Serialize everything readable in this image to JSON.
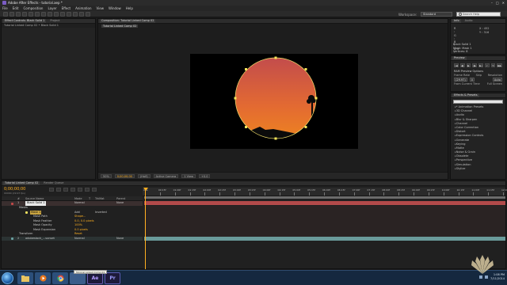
{
  "window": {
    "title": "Adobe After Effects - tutorial.aep *",
    "controls": [
      "–",
      "□",
      "✕"
    ]
  },
  "menu": [
    "File",
    "Edit",
    "Composition",
    "Layer",
    "Effect",
    "Animation",
    "View",
    "Window",
    "Help"
  ],
  "toolbar": {
    "workspace_label": "Workspace:",
    "workspace_value": "Standard",
    "search_placeholder": "Search Help"
  },
  "left_panel": {
    "tabs": [
      "Effect Controls: Black Solid 1",
      "Project"
    ],
    "subtitle": "Tutorial Linked Comp 02 • Black Solid 1"
  },
  "comp_panel": {
    "tab": "Composition: Tutorial Linked Comp 02",
    "subtab": "Tutorial Linked Comp 02",
    "footer": {
      "zoom": "50%",
      "timecode": "0;00;00;00",
      "resolution": "(Half)",
      "camera": "Active Camera",
      "views": "1 View",
      "offset": "+0.0"
    }
  },
  "info_panel": {
    "tabs": [
      "Info",
      "Audio"
    ],
    "rgb": [
      [
        "R :",
        ""
      ],
      [
        "G :",
        ""
      ],
      [
        "B :",
        ""
      ],
      [
        "A :",
        "0"
      ]
    ],
    "x": "X : 452",
    "y": "Y : 316",
    "layer_name": "Black Solid 1",
    "mask": "Mask: Mask 1",
    "vertices": "Vertices: 8"
  },
  "preview_panel": {
    "tab": "Preview",
    "ram_options": "RAM Preview Options",
    "frame_rate_label": "Frame Rate",
    "skip_label": "Skip",
    "resolution_label": "Resolution",
    "frame_rate_value": "(29.97)",
    "skip_value": "0",
    "resolution_value": "Auto",
    "from_current": "From Current Time",
    "full_screen": "Full Screen"
  },
  "effects_panel": {
    "tab": "Effects & Presets",
    "categories": [
      "* Animation Presets",
      "3D Channel",
      "Audio",
      "Blur & Sharpen",
      "Channel",
      "Color Correction",
      "Distort",
      "Expression Controls",
      "Generate",
      "Keying",
      "Matte",
      "Noise & Grain",
      "Obsolete",
      "Perspective",
      "Simulation",
      "Stylize"
    ]
  },
  "timeline": {
    "tabs": [
      "Tutorial Linked Comp 02",
      "Render Queue"
    ],
    "timecode": "0;00;00;00",
    "frames_fps": "00000 (29.97 fps)",
    "column_headers": [
      "#",
      "Source Name",
      "Mode",
      "T",
      "TrkMat",
      "Parent"
    ],
    "ruler_ticks": [
      "00s",
      "00:15f",
      "01:00f",
      "01:15f",
      "02:00f",
      "02:15f",
      "03:00f",
      "03:15f",
      "04:00f",
      "04:15f",
      "05:00f",
      "05:15f",
      "06:00f",
      "06:15f",
      "07:00f",
      "07:15f",
      "08:00f",
      "08:15f",
      "09:00f",
      "09:15f",
      "10:00f",
      "10:15f",
      "11:00f",
      "11:15f",
      "12:00f"
    ],
    "layers": [
      {
        "num": "1",
        "name": "Black Solid 1",
        "mode": "Normal",
        "parent": "None",
        "color": "#c24848"
      },
      {
        "name": "Masks"
      },
      {
        "name": "Mask 1",
        "mode": "Add",
        "inverted": "Inverted"
      },
      {
        "name": "Mask Path",
        "value": "Shape..."
      },
      {
        "name": "Mask Feather",
        "value": "0.0, 0.0 pixels"
      },
      {
        "name": "Mask Opacity",
        "value": "100%"
      },
      {
        "name": "Mask Expansion",
        "value": "0.0 pixels"
      },
      {
        "name": "Transform",
        "value": "Reset"
      },
      {
        "num": "2",
        "name": "adobestock_...sunset",
        "mode": "Normal",
        "parent": "None",
        "color": "#6aa0a0"
      }
    ]
  },
  "taskbar": {
    "apps": [
      "Ae",
      "Pr"
    ],
    "tooltip": "Tutorial Linked Comp 02",
    "time": "1:08 PM",
    "date": "7/11/2014"
  },
  "colors": {
    "accent": "#ffb020",
    "layer1": "#c24848",
    "layer2": "#6aa0a0",
    "taskbar": "#15283f"
  }
}
